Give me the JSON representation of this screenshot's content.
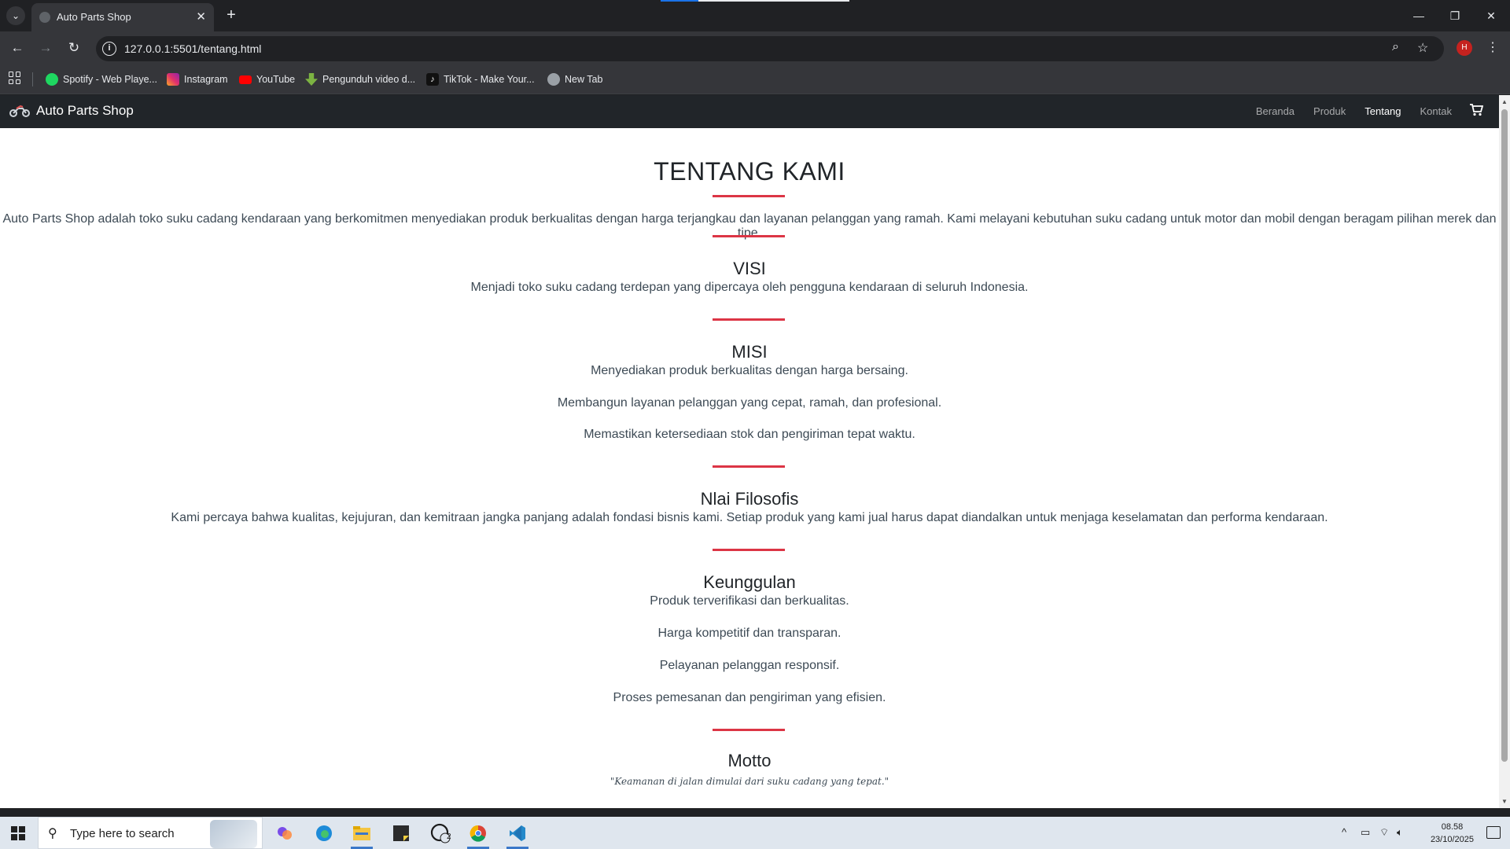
{
  "browser": {
    "tab_title": "Auto Parts Shop",
    "url": "127.0.0.1:5501/tentang.html",
    "profile_initial": "H",
    "bookmarks": [
      {
        "label": "Spotify - Web Playe...",
        "icon": "spotify-icon",
        "color": "#1ed760"
      },
      {
        "label": "Instagram",
        "icon": "instagram-icon",
        "color": "#e1306c"
      },
      {
        "label": "YouTube",
        "icon": "youtube-icon",
        "color": "#ff0000"
      },
      {
        "label": "Pengunduh video d...",
        "icon": "download-icon",
        "color": "#7cb342"
      },
      {
        "label": "TikTok - Make Your...",
        "icon": "tiktok-icon",
        "color": "#111111"
      },
      {
        "label": "New Tab",
        "icon": "globe-icon",
        "color": "#9aa0a6"
      }
    ]
  },
  "site": {
    "brand": "Auto Parts Shop",
    "nav": [
      {
        "label": "Beranda",
        "active": false
      },
      {
        "label": "Produk",
        "active": false
      },
      {
        "label": "Tentang",
        "active": true
      },
      {
        "label": "Kontak",
        "active": false
      }
    ],
    "accent_color": "#dc3545"
  },
  "about": {
    "title": "TENTANG KAMI",
    "intro": "Auto Parts Shop adalah toko suku cadang kendaraan yang berkomitmen menyediakan produk berkualitas dengan harga terjangkau dan layanan pelanggan yang ramah. Kami melayani kebutuhan suku cadang untuk motor dan mobil dengan beragam pilihan merek dan tipe.",
    "visi": {
      "heading": "VISI",
      "text": "Menjadi toko suku cadang terdepan yang dipercaya oleh pengguna kendaraan di seluruh Indonesia."
    },
    "misi": {
      "heading": "MISI",
      "items": [
        "Menyediakan produk berkualitas dengan harga bersaing.",
        "Membangun layanan pelanggan yang cepat, ramah, dan profesional.",
        "Memastikan ketersediaan stok dan pengiriman tepat waktu."
      ]
    },
    "filosofi": {
      "heading": "Nlai Filosofis",
      "text": "Kami percaya bahwa kualitas, kejujuran, dan kemitraan jangka panjang adalah fondasi bisnis kami. Setiap produk yang kami jual harus dapat diandalkan untuk menjaga keselamatan dan performa kendaraan."
    },
    "keunggulan": {
      "heading": "Keunggulan",
      "items": [
        "Produk terverifikasi dan berkualitas.",
        "Harga kompetitif dan transparan.",
        "Pelayanan pelanggan responsif.",
        "Proses pemesanan dan pengiriman yang efisien."
      ]
    },
    "motto": {
      "heading": "Motto",
      "text": "\"Keamanan di jalan dimulai dari suku cadang yang tepat.\""
    }
  },
  "taskbar": {
    "search_placeholder": "Type here to search",
    "whatsapp_badge": "2",
    "time": "08.58",
    "date": "23/10/2025"
  }
}
